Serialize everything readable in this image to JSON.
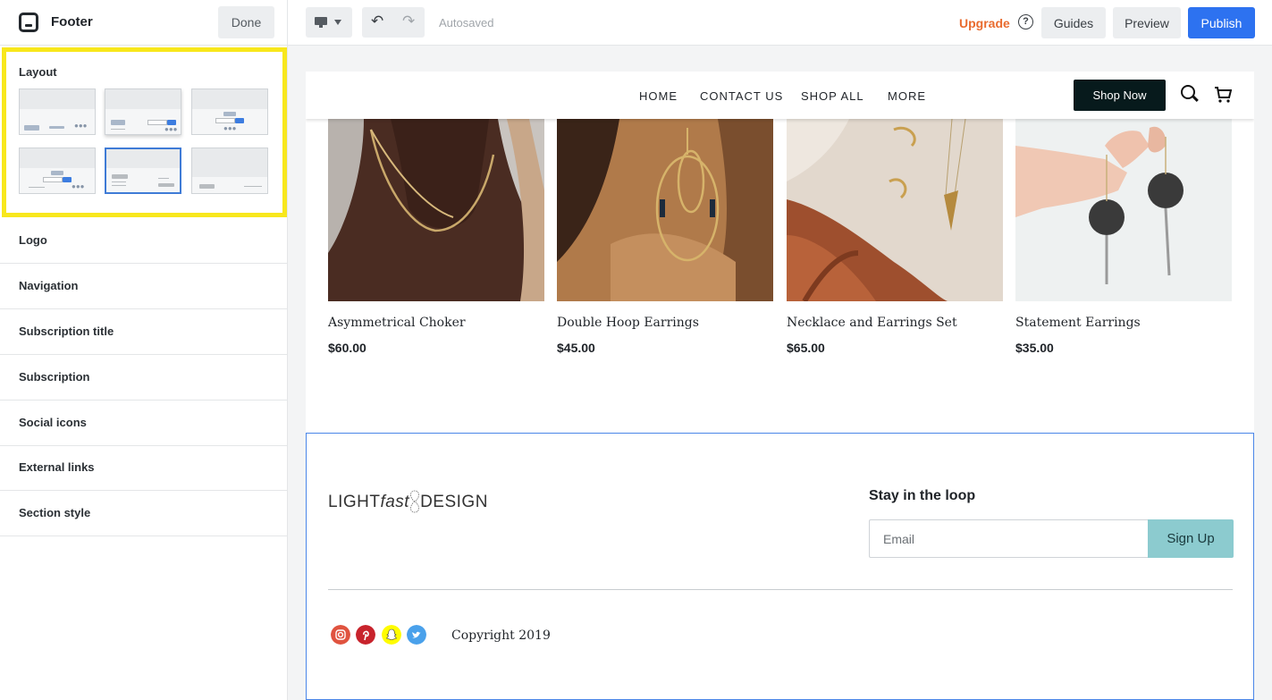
{
  "topbar": {
    "panel_title": "Footer",
    "done_label": "Done",
    "autosaved": "Autosaved",
    "upgrade": "Upgrade",
    "guides": "Guides",
    "preview": "Preview",
    "publish": "Publish",
    "accent_color": "#2d72f0",
    "upgrade_color": "#e96b2e"
  },
  "sidebar": {
    "layout_title": "Layout",
    "layout_selected_index": 4,
    "rows": [
      "Logo",
      "Navigation",
      "Subscription title",
      "Subscription",
      "Social icons",
      "External links",
      "Section style"
    ]
  },
  "site": {
    "nav": [
      "HOME",
      "CONTACT US",
      "SHOP ALL",
      "MORE"
    ],
    "shop_now": "Shop Now",
    "products": [
      {
        "name": "Asymmetrical Choker",
        "price": "$60.00"
      },
      {
        "name": "Double Hoop Earrings",
        "price": "$45.00"
      },
      {
        "name": "Necklace and Earrings Set",
        "price": "$65.00"
      },
      {
        "name": "Statement Earrings",
        "price": "$35.00"
      }
    ],
    "footer": {
      "logo_part1": "LIGHT",
      "logo_part2": "fast",
      "logo_part3": "DESIGN",
      "subscription_title": "Stay in the loop",
      "email_placeholder": "Email",
      "signup_label": "Sign Up",
      "copyright": "Copyright 2019",
      "social": [
        "instagram-icon",
        "pinterest-icon",
        "snapchat-icon",
        "twitter-icon"
      ]
    }
  }
}
